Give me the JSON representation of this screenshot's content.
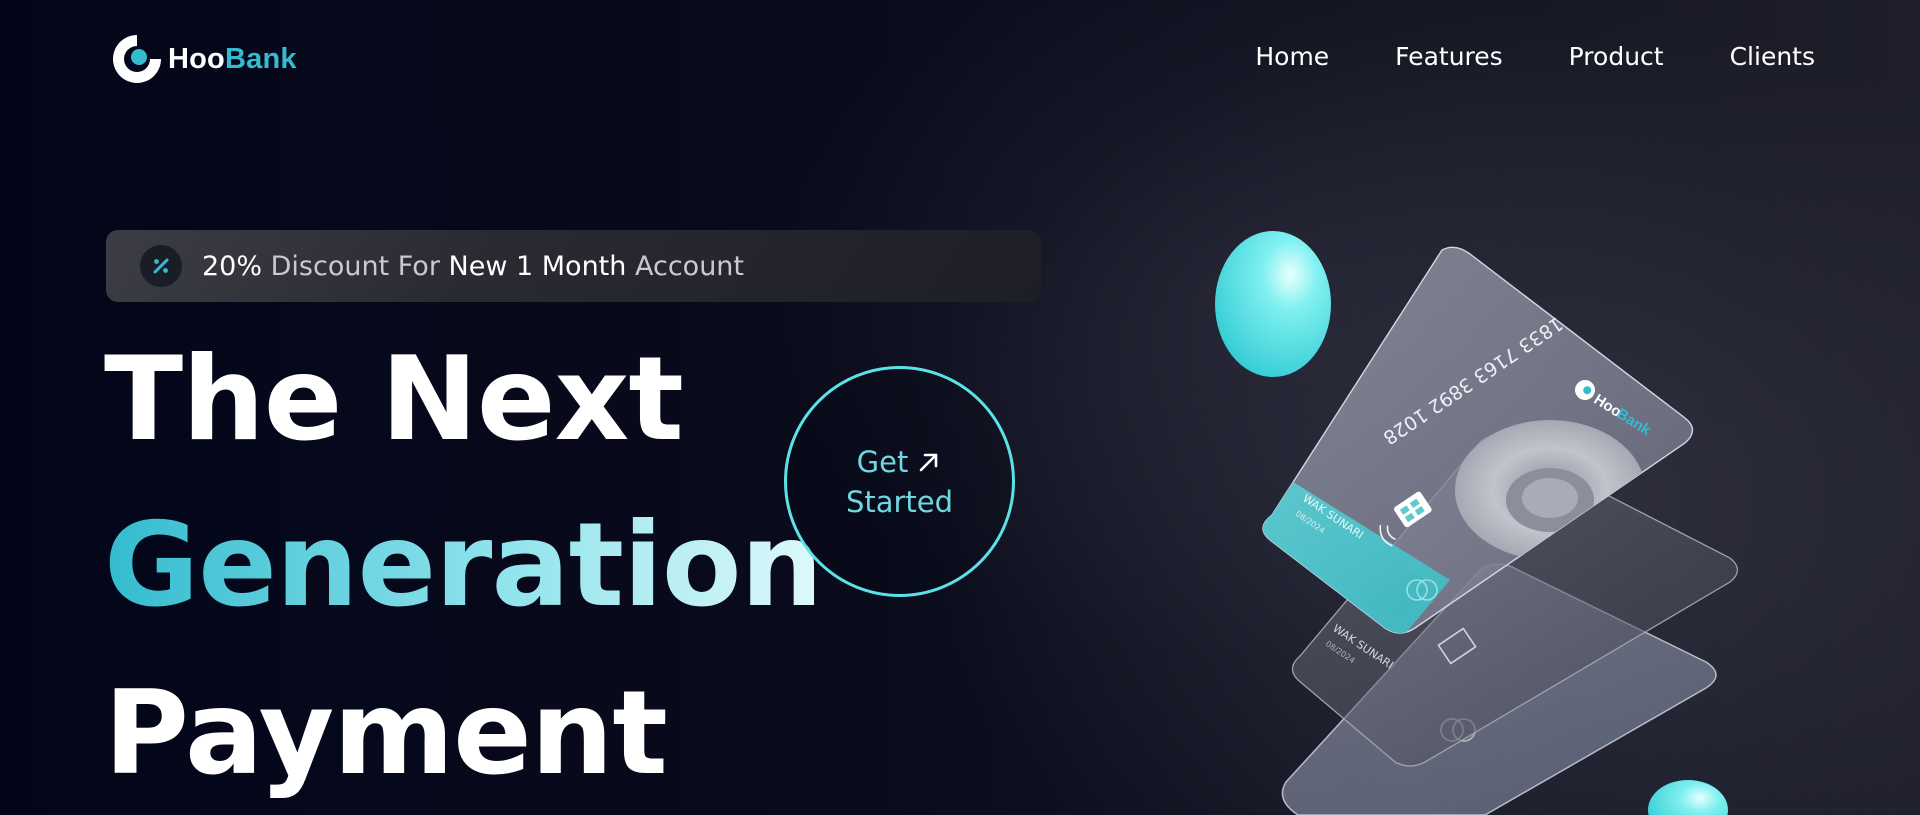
{
  "brand": {
    "name_part1": "Hoo",
    "name_part2": "Bank",
    "primary_color": "#33bbcf",
    "accent_color": "#5ce1e6",
    "background_color": "#00040f"
  },
  "nav": {
    "links": [
      "Home",
      "Features",
      "Product",
      "Clients"
    ]
  },
  "discount": {
    "icon": "discount-percent-icon",
    "percent": "20%",
    "text1": "Discount For",
    "highlight": "New 1 Month",
    "text2": "Account"
  },
  "hero": {
    "line1": "The Next",
    "line2": "Generation",
    "line3": "Payment"
  },
  "cta": {
    "line1": "Get",
    "line2": "Started",
    "icon": "arrow-up-right-icon"
  },
  "cards": {
    "number": "1833 7163 3892 1028",
    "holder": "WAK SUNARI",
    "expiry": "08/2024",
    "brand_part1": "Hoo",
    "brand_part2": "Bank"
  }
}
